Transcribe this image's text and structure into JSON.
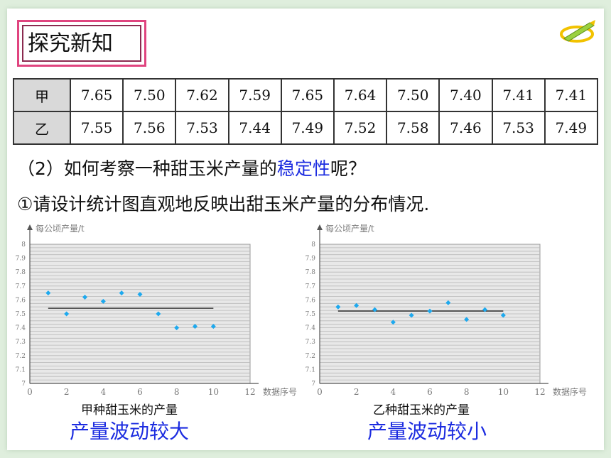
{
  "title": "探究新知",
  "icons": {
    "decoration": "pencil-icon"
  },
  "table": {
    "rows": [
      {
        "label": "甲",
        "values": [
          "7.65",
          "7.50",
          "7.62",
          "7.59",
          "7.65",
          "7.64",
          "7.50",
          "7.40",
          "7.41",
          "7.41"
        ]
      },
      {
        "label": "乙",
        "values": [
          "7.55",
          "7.56",
          "7.53",
          "7.44",
          "7.49",
          "7.52",
          "7.58",
          "7.46",
          "7.53",
          "7.49"
        ]
      }
    ]
  },
  "question": {
    "prefix": "（2）如何考察一种甜玉米产量的",
    "highlight": "稳定性",
    "suffix": "呢？"
  },
  "instruction": "①请设计统计图直观地反映出甜玉米产量的分布情况.",
  "colors": {
    "title_border": "#e0447f",
    "highlight": "#1c2ce0",
    "point": "#1ea9ee",
    "plot_bg": "#e8e8e8"
  },
  "chart_data": [
    {
      "type": "scatter",
      "ylabel": "每公顷产量/t",
      "xlabel": "数据序号",
      "x_ticks": [
        "0",
        "2",
        "4",
        "6",
        "8",
        "10",
        "12"
      ],
      "y_ticks": [
        "7",
        "7.1",
        "7.2",
        "7.3",
        "7.4",
        "7.5",
        "7.6",
        "7.7",
        "7.8",
        "7.9",
        "8"
      ],
      "xlim": [
        0,
        12
      ],
      "ylim": [
        7,
        8
      ],
      "x": [
        1,
        2,
        3,
        4,
        5,
        6,
        7,
        8,
        9,
        10
      ],
      "y": [
        7.65,
        7.5,
        7.62,
        7.59,
        7.65,
        7.64,
        7.5,
        7.4,
        7.41,
        7.41
      ],
      "mean_line": 7.54,
      "caption": "甲种甜玉米的产量",
      "conclusion": "产量波动较大"
    },
    {
      "type": "scatter",
      "ylabel": "每公顷产量/t",
      "xlabel": "数据序号",
      "x_ticks": [
        "0",
        "2",
        "4",
        "6",
        "8",
        "10",
        "12"
      ],
      "y_ticks": [
        "7",
        "7.1",
        "7.2",
        "7.3",
        "7.4",
        "7.5",
        "7.6",
        "7.7",
        "7.8",
        "7.9",
        "8"
      ],
      "xlim": [
        0,
        12
      ],
      "ylim": [
        7,
        8
      ],
      "x": [
        1,
        2,
        3,
        4,
        5,
        6,
        7,
        8,
        9,
        10
      ],
      "y": [
        7.55,
        7.56,
        7.53,
        7.44,
        7.49,
        7.52,
        7.58,
        7.46,
        7.53,
        7.49
      ],
      "mean_line": 7.52,
      "caption": "乙种甜玉米的产量",
      "conclusion": "产量波动较小"
    }
  ]
}
